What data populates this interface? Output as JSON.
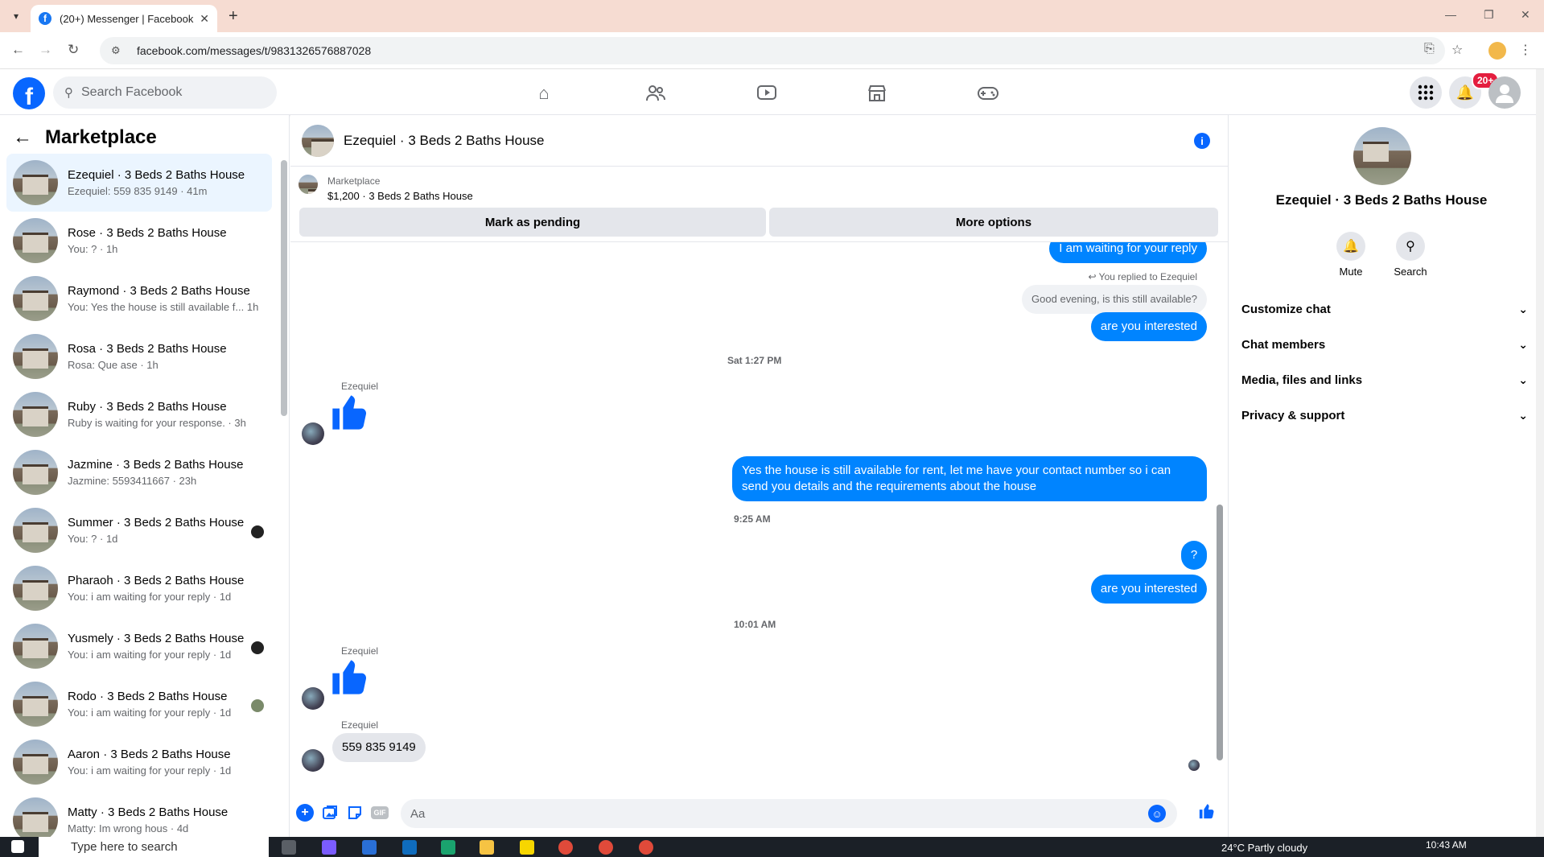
{
  "browser": {
    "tab_title": "(20+) Messenger | Facebook",
    "url": "facebook.com/messages/t/9831326576887028"
  },
  "fb": {
    "search_placeholder": "Search Facebook",
    "notif_badge": "20+"
  },
  "left": {
    "title": "Marketplace",
    "conversations": [
      {
        "name": "Ezequiel · 3 Beds 2 Baths House",
        "snippet": "Ezequiel: 559 835 9149 · 41m",
        "active": true
      },
      {
        "name": "Rose · 3 Beds 2 Baths House",
        "snippet": "You: ? · 1h"
      },
      {
        "name": "Raymond · 3 Beds 2 Baths House",
        "snippet": "You: Yes the house is still available f...  1h"
      },
      {
        "name": "Rosa · 3 Beds 2 Baths House",
        "snippet": "Rosa: Que ase · 1h"
      },
      {
        "name": "Ruby · 3 Beds 2 Baths House",
        "snippet": "Ruby is waiting for your response. · 3h"
      },
      {
        "name": "Jazmine · 3 Beds 2 Baths House",
        "snippet": "Jazmine: 5593411667 · 23h"
      },
      {
        "name": "Summer · 3 Beds 2 Baths House",
        "snippet": "You: ? · 1d"
      },
      {
        "name": "Pharaoh · 3 Beds 2 Baths House",
        "snippet": "You: i am waiting for your reply · 1d"
      },
      {
        "name": "Yusmely · 3 Beds 2 Baths House",
        "snippet": "You: i am waiting for your reply · 1d"
      },
      {
        "name": "Rodo · 3 Beds 2 Baths House",
        "snippet": "You: i am waiting for your reply · 1d"
      },
      {
        "name": "Aaron · 3 Beds 2 Baths House",
        "snippet": "You: i am waiting for your reply · 1d"
      },
      {
        "name": "Matty · 3 Beds 2 Baths House",
        "snippet": "Matty: Im wrong hous · 4d"
      }
    ]
  },
  "chat": {
    "title": "Ezequiel · 3 Beds 2 Baths House",
    "marketplace_label": "Marketplace",
    "listing": "$1,200 · 3 Beds 2 Baths House",
    "mark_pending": "Mark as pending",
    "more_options": "More options",
    "messages": {
      "m1": "I am waiting for your reply",
      "replied_to": "You replied to Ezequiel",
      "quoted": "Good evening, is this still available?",
      "m2": "are you interested",
      "ts1": "Sat 1:27 PM",
      "sender": "Ezequiel",
      "m3": "Yes the house is still available for rent, let me have your contact number so i can send you details and the requirements about the house",
      "ts2": "9:25 AM",
      "m4": "?",
      "m5": "are you interested",
      "ts3": "10:01 AM",
      "m6": "559 835 9149"
    },
    "composer_placeholder": "Aa"
  },
  "right": {
    "name": "Ezequiel · 3 Beds 2 Baths House",
    "mute": "Mute",
    "search": "Search",
    "sections": [
      "Customize chat",
      "Chat members",
      "Media, files and links",
      "Privacy & support"
    ]
  },
  "taskbar": {
    "search_placeholder": "Type here to search",
    "weather": "24°C  Partly cloudy",
    "time": "10:43 AM"
  },
  "colors": {
    "accent": "#0866ff",
    "bubble_out": "#0084ff"
  }
}
